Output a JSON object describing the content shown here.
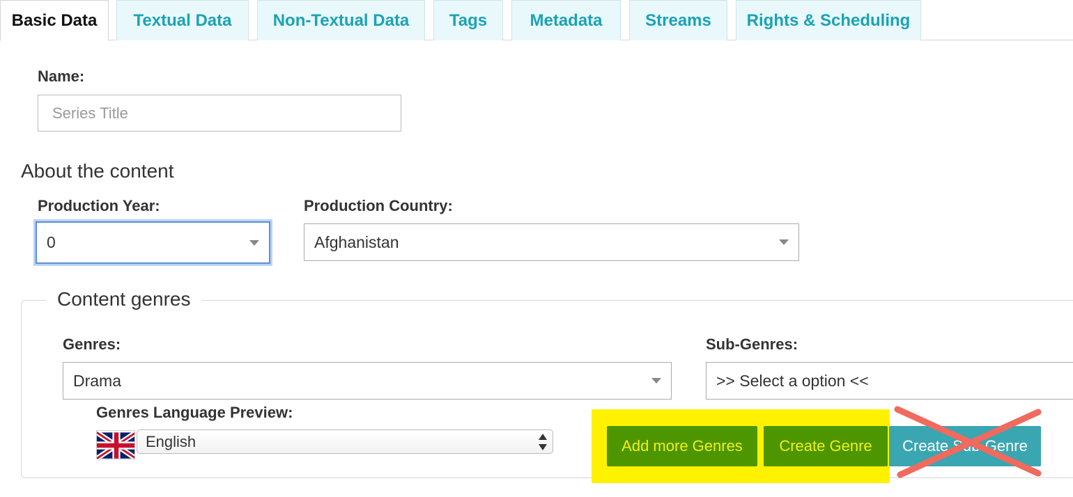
{
  "tabs": [
    {
      "label": "Basic Data",
      "active": true
    },
    {
      "label": "Textual Data",
      "active": false
    },
    {
      "label": "Non-Textual Data",
      "active": false
    },
    {
      "label": "Tags",
      "active": false
    },
    {
      "label": "Metadata",
      "active": false
    },
    {
      "label": "Streams",
      "active": false
    },
    {
      "label": "Rights & Scheduling",
      "active": false
    }
  ],
  "name_field": {
    "label": "Name:",
    "placeholder": "Series Title",
    "value": ""
  },
  "about_section": {
    "title": "About the content"
  },
  "production_year": {
    "label": "Production Year:",
    "value": "0"
  },
  "production_country": {
    "label": "Production Country:",
    "value": "Afghanistan"
  },
  "genres_section": {
    "legend": "Content genres",
    "genres_label": "Genres:",
    "genres_value": "Drama",
    "subgenres_label": "Sub-Genres:",
    "subgenres_value": ">> Select a option <<",
    "language_label": "Genres Language Preview:",
    "language_value": "English",
    "flag_icon": "uk-flag-icon"
  },
  "buttons": {
    "add_more_genres": "Add more Genres",
    "create_genre": "Create Genre",
    "create_sub_genre": "Create Sub-Genre"
  },
  "colors": {
    "tab_text": "#1aa3b5",
    "tab_bg": "#e9f8fb",
    "highlight": "#fff200",
    "green_button": "#4d9600",
    "green_button_text": "#f2ee12",
    "teal_button": "#3aa6b2",
    "cross_mark": "#f06a5e"
  }
}
